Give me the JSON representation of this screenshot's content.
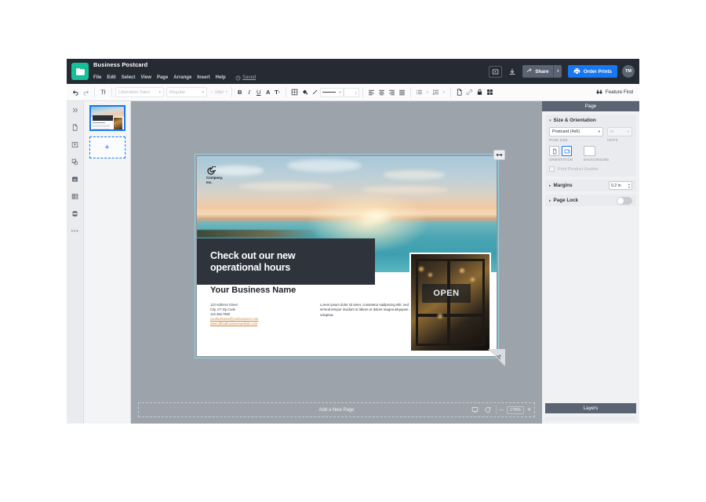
{
  "header": {
    "doc_title": "Business Postcard",
    "menu": [
      "File",
      "Edit",
      "Select",
      "View",
      "Page",
      "Arrange",
      "Insert",
      "Help"
    ],
    "saved_label": "Saved",
    "present_icon": "play-box-icon",
    "download_icon": "download-icon",
    "share_label": "Share",
    "share_icon": "share-icon",
    "share_caret": "▾",
    "order_label": "Order Prints",
    "order_icon": "printer-icon",
    "avatar_initials": "TM",
    "accent_blue": "#1877f2",
    "brand_green": "#18c09a",
    "header_bg": "#262b33"
  },
  "toolbar": {
    "undo_icon": "undo-icon",
    "redo_icon": "redo-icon",
    "text_tool_icon": "text-format-icon",
    "font_family": "Liberation Sans",
    "font_style": "Regular",
    "font_size": "18pt",
    "size_minus": "–",
    "size_plus": "+",
    "bold_label": "B",
    "italic_label": "I",
    "underline_label": "U",
    "font_color_label": "A",
    "spacing_label": "T·",
    "border_icon": "border-icon",
    "fill_icon": "fill-bucket-icon",
    "line_icon": "line-icon",
    "line_style_value": "—",
    "line_width_value": "",
    "align_icons": [
      "align-left-icon",
      "align-center-icon",
      "align-right-icon",
      "align-justify-icon"
    ],
    "bullet_list_icon": "bullet-list-icon",
    "numbered_list_icon": "numbered-list-icon",
    "page_icon": "page-icon",
    "link_icon": "link-icon",
    "lock_icon": "lock-icon",
    "grid_icon": "grid-icon",
    "feature_find_label": "Feature Find",
    "feature_find_icon": "binoculars-icon"
  },
  "rail": {
    "items": [
      {
        "name": "expand-panel-icon"
      },
      {
        "name": "page-icon"
      },
      {
        "name": "text-box-icon"
      },
      {
        "name": "shapes-icon"
      },
      {
        "name": "image-icon"
      },
      {
        "name": "table-icon"
      },
      {
        "name": "database-icon"
      },
      {
        "name": "more-options-icon",
        "glyph": "•••"
      }
    ]
  },
  "pages_panel": {
    "add_page_glyph": "+"
  },
  "canvas": {
    "add_new_page_label": "Add a New Page",
    "zoom_value": "178%",
    "zoom_out": "–",
    "zoom_in": "+",
    "preview_icon": "monitor-icon",
    "comment_icon": "comment-icon",
    "handle_east_icon": "resize-horizontal-icon",
    "handle_corner_icon": "resize-diagonal-icon"
  },
  "postcard": {
    "logo_line1": "Company,",
    "logo_line2": "Inc.",
    "headline_line1": "Check out our new",
    "headline_line2": "operational hours",
    "business_name": "Your Business Name",
    "address": [
      {
        "text": "123 Address Street",
        "link": false
      },
      {
        "text": "City, ST Zip Code",
        "link": false
      },
      {
        "text": "123.456.7890",
        "link": false
      },
      {
        "text": "yourbusiness@yourbusiness.com",
        "link": true
      },
      {
        "text": "www.officialbusinesswebsite.com",
        "link": true
      }
    ],
    "lorem": "Lorem ipsum dolor sit amet, consetetur sadipscing elitr, sed diam nonumy eirmod tempor invidunt ut labore et dolore magna aliquyam erat, sed diam voluptua.",
    "open_sign_text": "OPEN",
    "band_bg": "#2e333c"
  },
  "right_panel": {
    "title": "Page",
    "size_section": "Size & Orientation",
    "page_size_value": "Postcard (4x6)",
    "page_size_caption": "PAGE SIZE",
    "units_value": "in",
    "units_caption": "UNITS",
    "orientation_caption": "ORIENTATION",
    "background_caption": "BACKGROUND",
    "print_guides_label": "Print Product Guides",
    "margins_label": "Margins",
    "margins_value": "0.2 in",
    "page_lock_label": "Page Lock",
    "layers_label": "Layers",
    "caret_collapsed": "▸",
    "caret_expanded": "▾"
  }
}
